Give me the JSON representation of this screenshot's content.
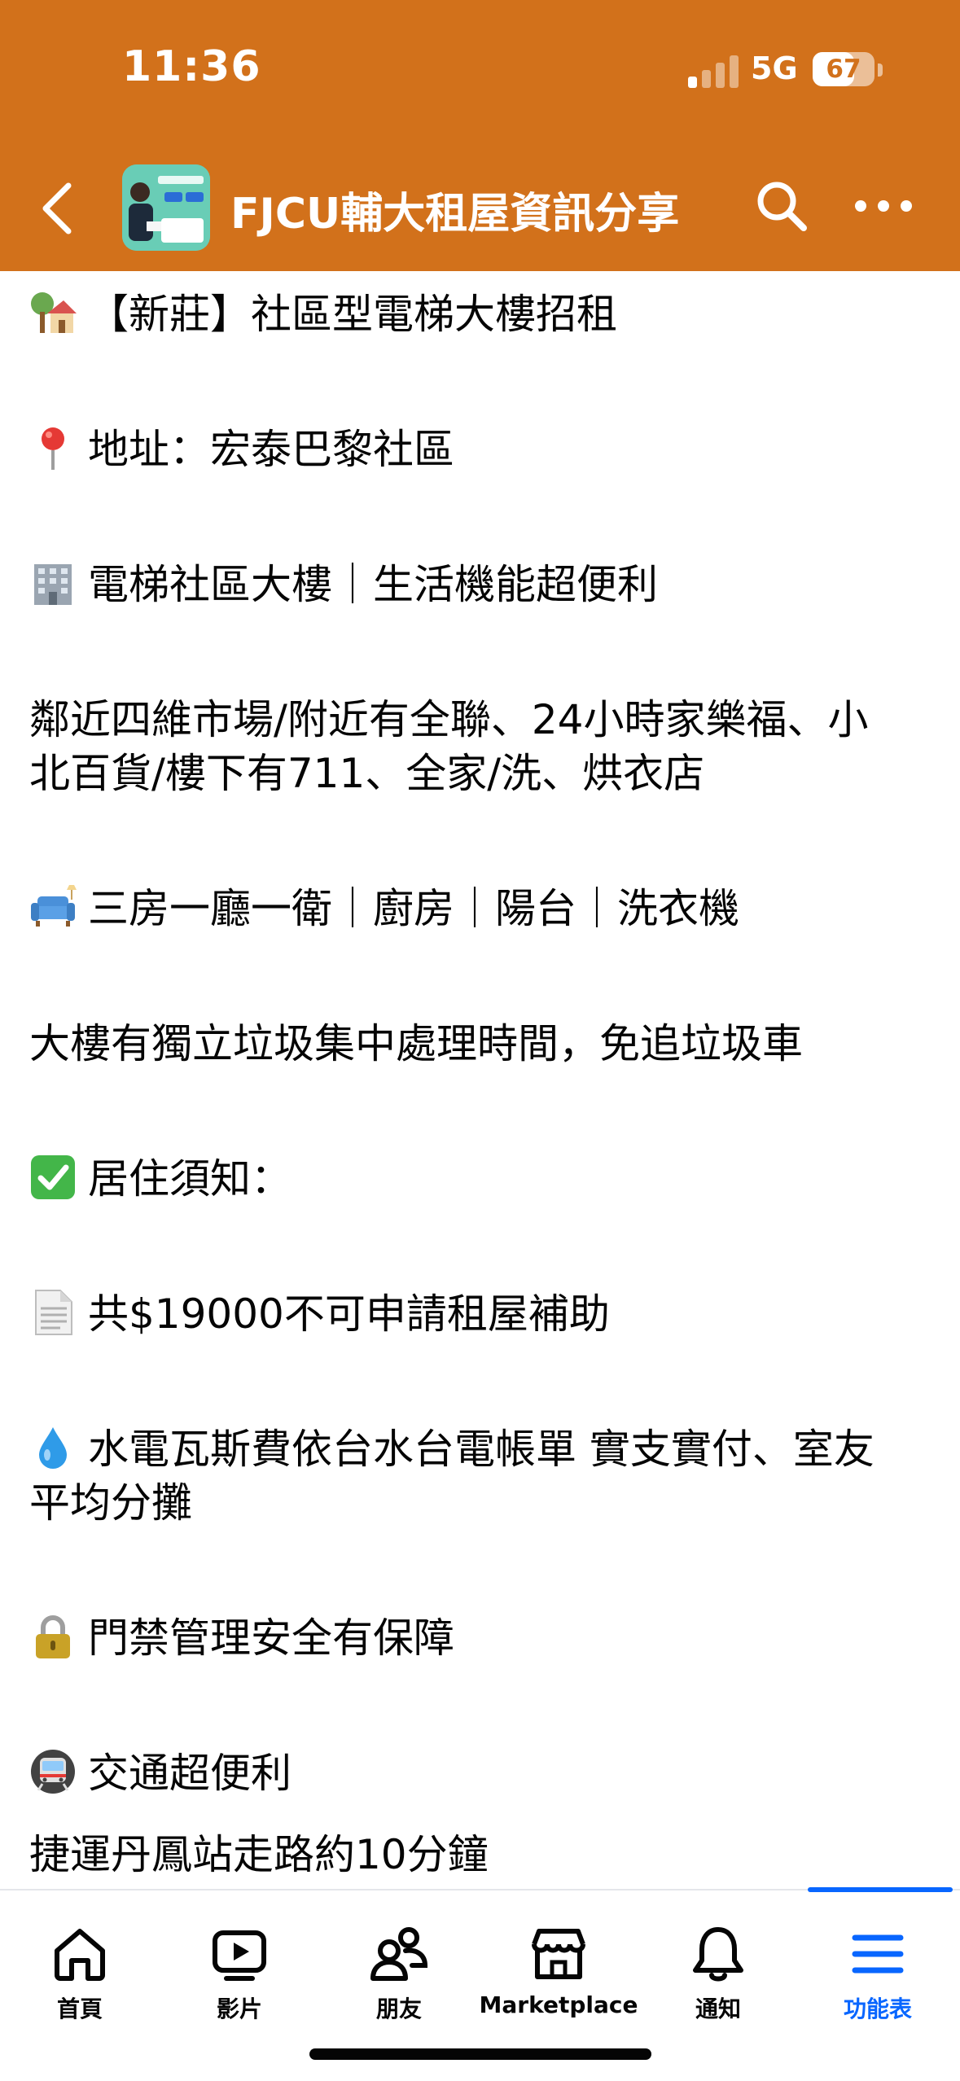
{
  "status_bar": {
    "time": "11:36",
    "network": "5G",
    "battery": "67",
    "battery_level": 0.67
  },
  "header": {
    "title": "FJCU輔大租屋資訊分享",
    "back_icon": "chevron-left-icon",
    "search_icon": "search-icon",
    "more_icon": "more-horizontal-icon",
    "background_color": "#D2711B"
  },
  "post": {
    "lines": [
      {
        "text": "【新莊】社區型電梯大樓招租",
        "emoji": "house-with-garden"
      },
      {
        "text": "地址：宏泰巴黎社區",
        "emoji": "round-pushpin"
      },
      {
        "text": "電梯社區大樓｜生活機能超便利",
        "emoji": "office-building"
      },
      {
        "text": "鄰近四維市場/附近有全聯、24小時家樂福、小",
        "emoji": ""
      },
      {
        "text": "北百貨/樓下有711、全家/洗、烘衣店",
        "emoji": ""
      },
      {
        "text": "三房一廳一衛｜廚房｜陽台｜洗衣機",
        "emoji": "couch"
      },
      {
        "text": "大樓有獨立垃圾集中處理時間，免追垃圾車",
        "emoji": ""
      },
      {
        "text": "居住須知：",
        "emoji": "check-mark-button"
      },
      {
        "text": "共$19000不可申請租屋補助",
        "emoji": "page-facing-up"
      },
      {
        "text": "水電瓦斯費依台水台電帳單 實支實付、室友",
        "emoji": "droplet"
      },
      {
        "text": "平均分攤",
        "emoji": ""
      },
      {
        "text": "門禁管理安全有保障",
        "emoji": "locked"
      },
      {
        "text": "交通超便利",
        "emoji": "metro"
      },
      {
        "text": "捷運丹鳳站走路約10分鐘",
        "emoji": ""
      }
    ]
  },
  "bottom_nav": {
    "items": [
      {
        "label": "首頁",
        "icon": "home-icon"
      },
      {
        "label": "影片",
        "icon": "video-icon"
      },
      {
        "label": "朋友",
        "icon": "friends-icon"
      },
      {
        "label": "Marketplace",
        "icon": "marketplace-icon"
      },
      {
        "label": "通知",
        "icon": "bell-icon"
      },
      {
        "label": "功能表",
        "icon": "menu-icon"
      }
    ],
    "active_color": "#0866ff"
  }
}
